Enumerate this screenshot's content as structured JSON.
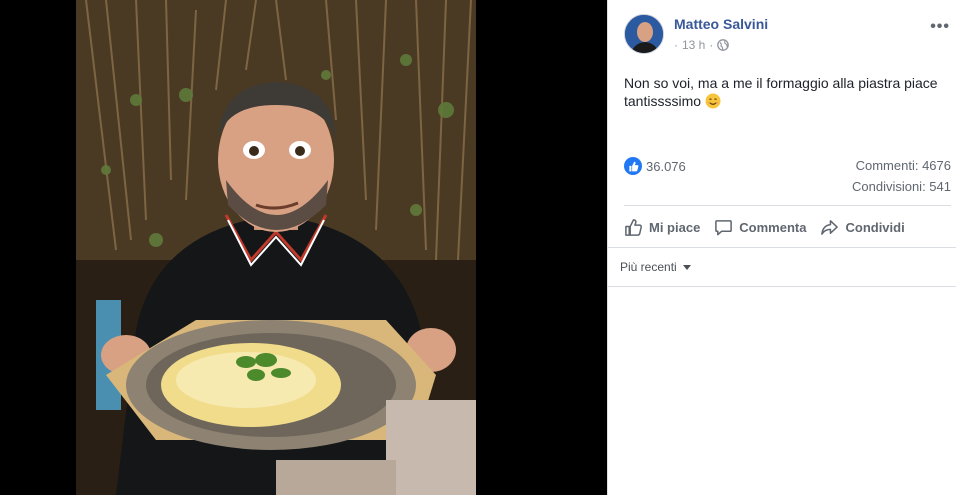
{
  "post": {
    "author": "Matteo Salvini",
    "time": "13 h",
    "time_separator": "·",
    "text_line1": "Non so voi, ma a me il formaggio alla piastra piace",
    "text_line2": "tantissssimo",
    "photo_alt": "Photo of a man holding a metal plate with melted cheese and basil"
  },
  "stats": {
    "likes": "36.076",
    "comments": "Commenti: 4676",
    "shares": "Condivisioni: 541"
  },
  "actions": {
    "like": "Mi piace",
    "comment": "Commenta",
    "share": "Condividi"
  },
  "comments": {
    "sort_label": "Più recenti"
  },
  "icons": {
    "more": "more-options-icon",
    "privacy": "globe-icon",
    "emoji": "smiling-face-icon",
    "like_reaction": "like-reaction-icon"
  },
  "colors": {
    "author": "#385898",
    "like_blue": "#2078f4",
    "muted": "#606770"
  }
}
